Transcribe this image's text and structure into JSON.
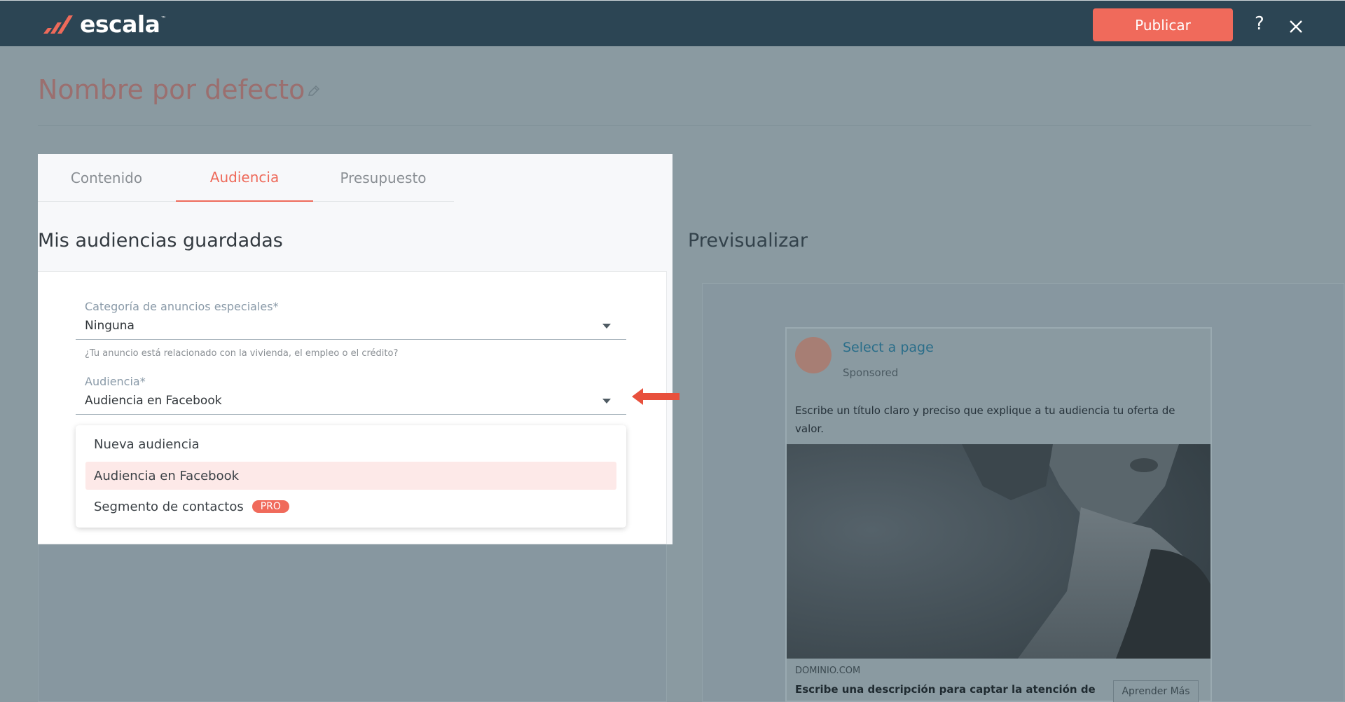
{
  "header": {
    "brand": "escala",
    "brand_tm": "™",
    "publish_label": "Publicar",
    "help_label": "?"
  },
  "page": {
    "title": "Nombre por defecto"
  },
  "tabs": [
    {
      "label": "Contenido"
    },
    {
      "label": "Audiencia"
    },
    {
      "label": "Presupuesto"
    }
  ],
  "section_title": "Mis audiencias guardadas",
  "form": {
    "category": {
      "label": "Categoría de anuncios especiales*",
      "value": "Ninguna",
      "hint": "¿Tu anuncio está relacionado con la vivienda, el empleo o el crédito?"
    },
    "audience": {
      "label": "Audiencia*",
      "value": "Audiencia en Facebook"
    },
    "dropdown_options": [
      {
        "label": "Nueva audiencia"
      },
      {
        "label": "Audiencia en Facebook"
      },
      {
        "label": "Segmento de contactos",
        "badge": "PRO"
      }
    ]
  },
  "preview": {
    "title": "Previsualizar",
    "page_name": "Select a page",
    "sponsored": "Sponsored",
    "ad_text": "Escribe un título claro y preciso que explique a tu audiencia tu oferta de valor.",
    "domain": "DOMINIO.COM",
    "description": "Escribe una descripción para captar la atención de",
    "cta_label": "Aprender Más"
  },
  "colors": {
    "accent": "#f06a5b",
    "header_bg": "#2c4554",
    "overlay_bg": "#8a9aa1"
  }
}
